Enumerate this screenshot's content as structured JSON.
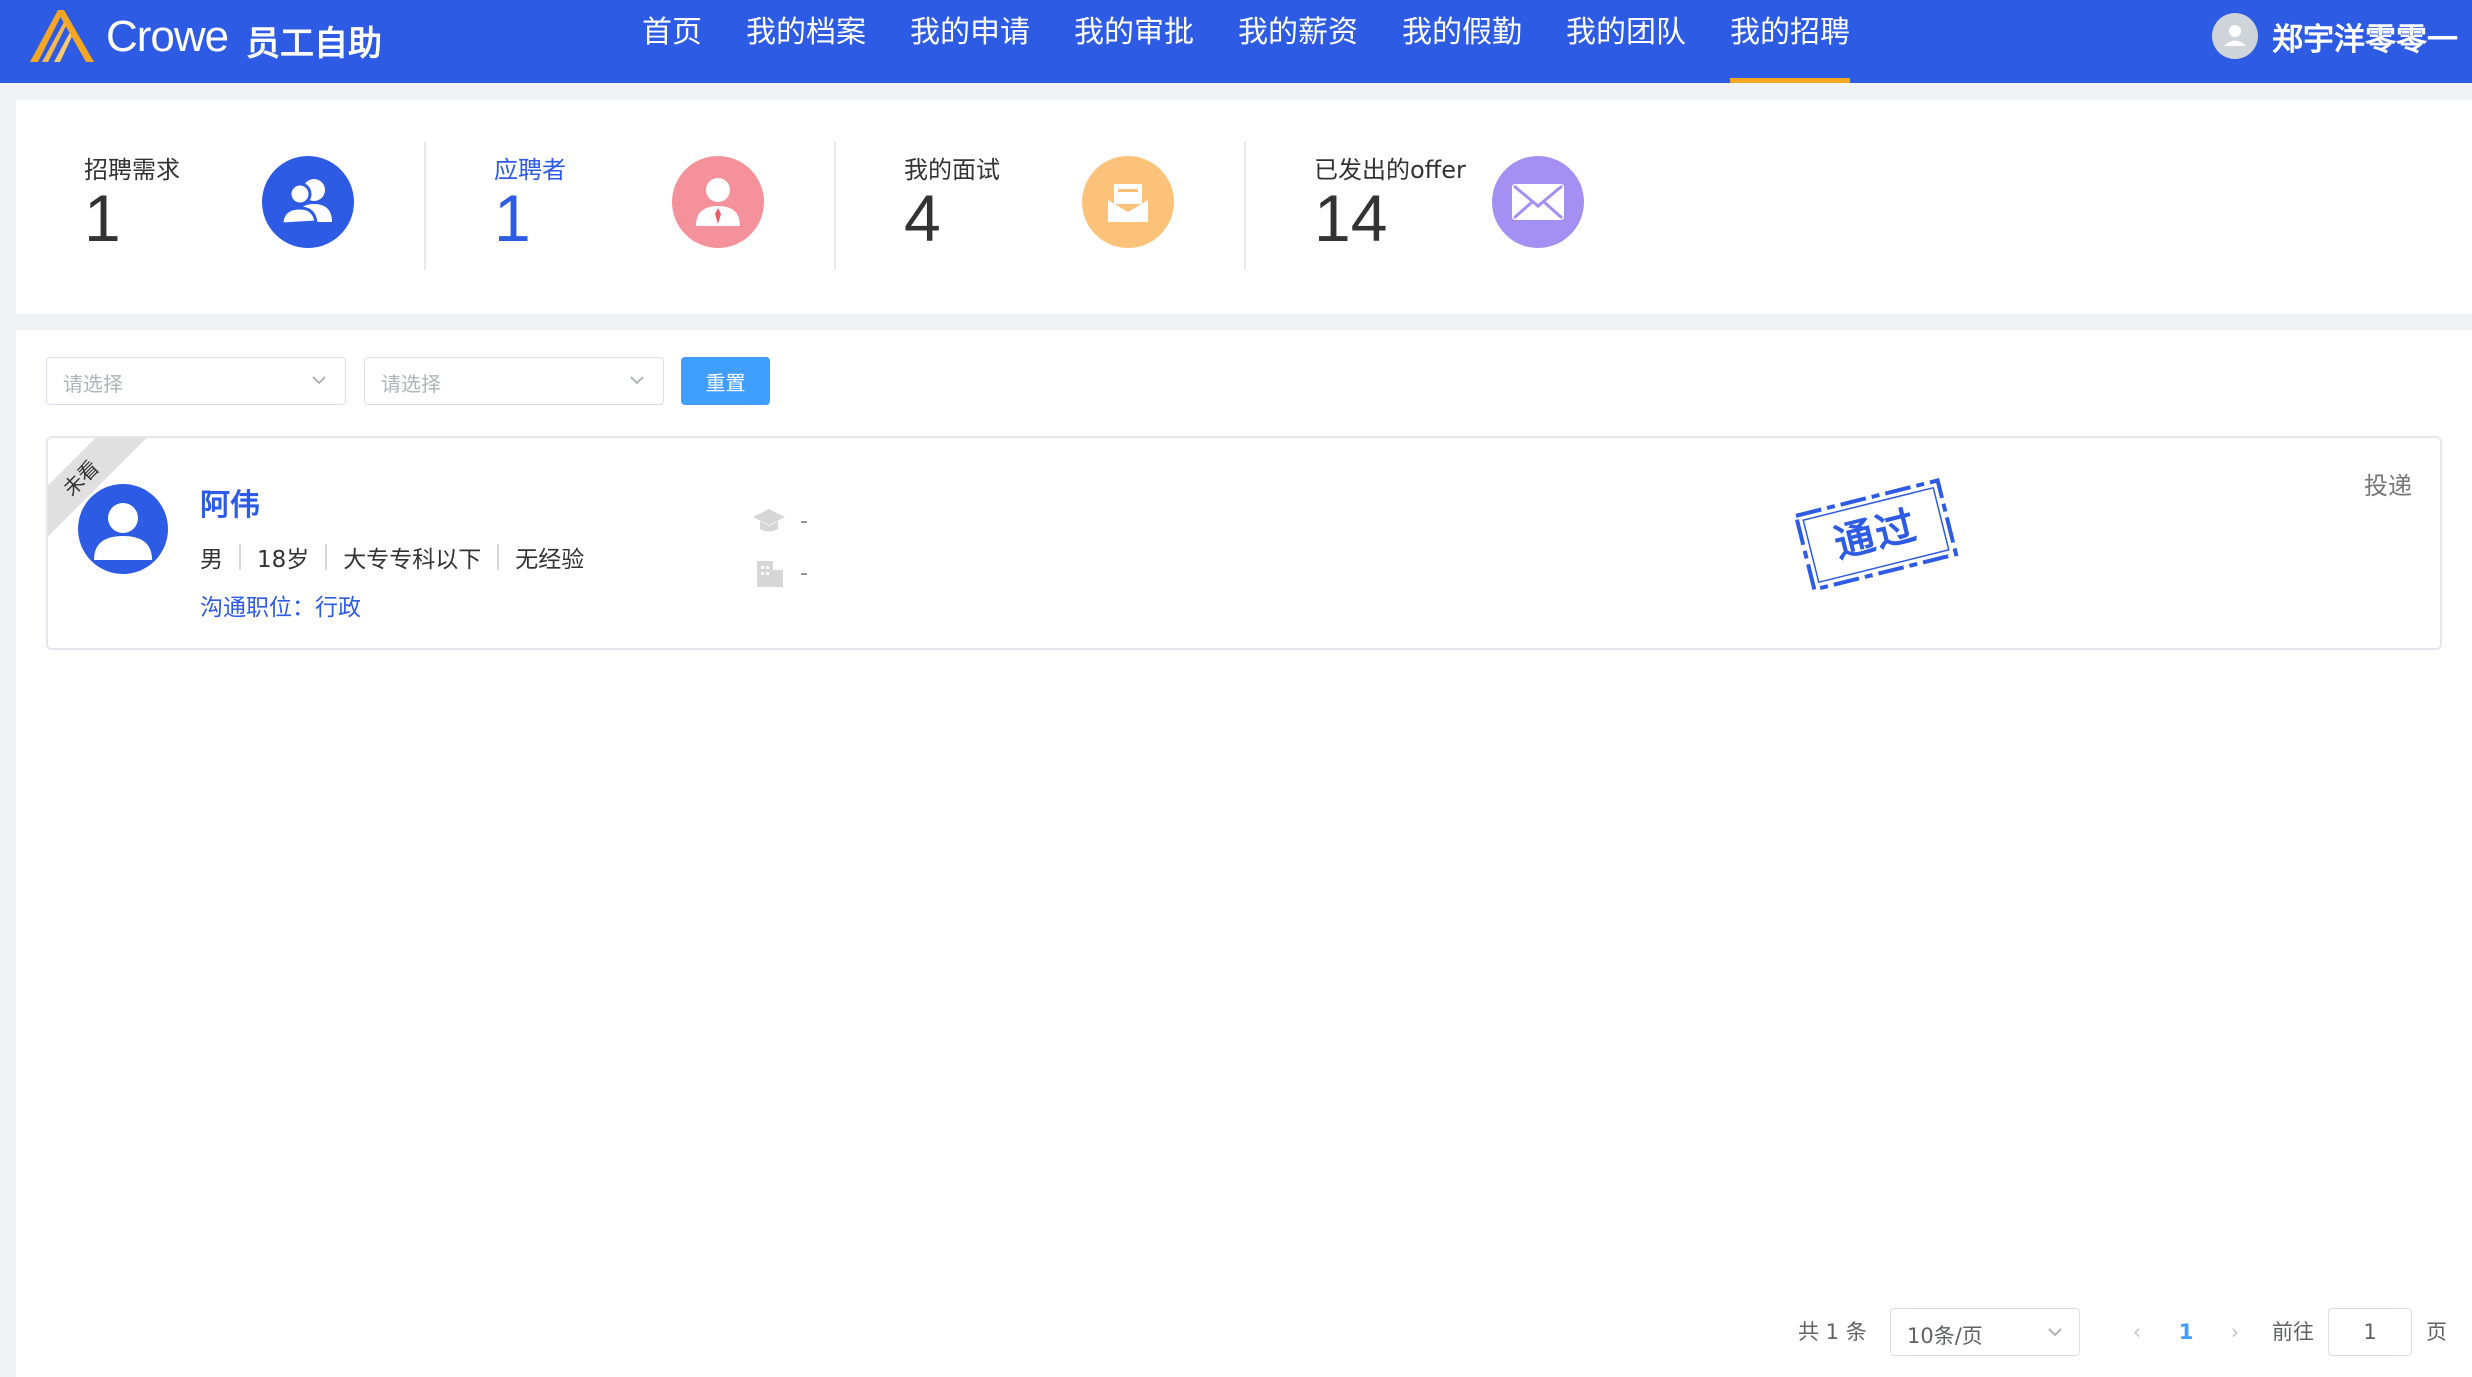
{
  "header": {
    "brand": "Crowe",
    "subtitle": "员工自助",
    "nav": [
      {
        "label": "首页"
      },
      {
        "label": "我的档案"
      },
      {
        "label": "我的申请"
      },
      {
        "label": "我的审批"
      },
      {
        "label": "我的薪资"
      },
      {
        "label": "我的假勤"
      },
      {
        "label": "我的团队"
      },
      {
        "label": "我的招聘"
      }
    ],
    "active_nav": "我的招聘",
    "user_name": "郑宇洋零零一"
  },
  "stats": [
    {
      "label": "招聘需求",
      "value": "1",
      "icon": "users-icon",
      "color": "#2d5be3"
    },
    {
      "label": "应聘者",
      "value": "1",
      "icon": "applicant-icon",
      "color": "#f4919a"
    },
    {
      "label": "我的面试",
      "value": "4",
      "icon": "interview-icon",
      "color": "#fcc27a"
    },
    {
      "label": "已发出的offer",
      "value": "14",
      "icon": "mail-icon",
      "color": "#a48ff2"
    }
  ],
  "filters": {
    "select1_placeholder": "请选择",
    "select2_placeholder": "请选择",
    "reset_label": "重置"
  },
  "candidate": {
    "ribbon": "未看",
    "name": "阿伟",
    "gender": "男",
    "age": "18岁",
    "education": "大专专科以下",
    "experience": "无经验",
    "position": "沟通职位：行政",
    "school": "-",
    "company": "-",
    "stamp": "通过",
    "action": "投递"
  },
  "pagination": {
    "total": "共 1 条",
    "page_size": "10条/页",
    "prev": "‹",
    "current": "1",
    "next": "›",
    "goto_label": "前往",
    "goto_value": "1",
    "goto_unit": "页"
  }
}
